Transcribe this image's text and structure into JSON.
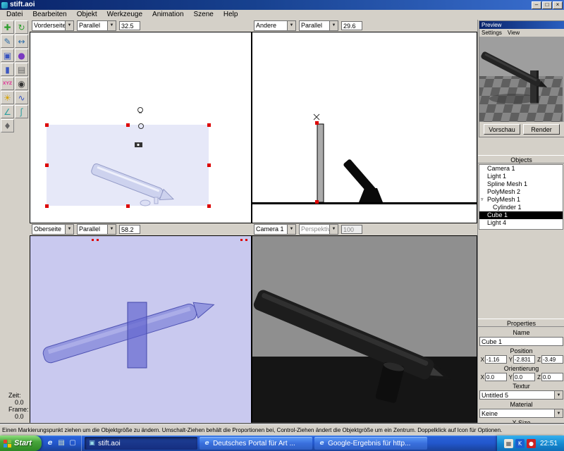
{
  "icons": {
    "chevron_down": "▼",
    "minimize": "–",
    "maximize": "□",
    "close": "×"
  },
  "window": {
    "title": "stift.aoi"
  },
  "menubar": [
    "Datei",
    "Bearbeiten",
    "Objekt",
    "Werkzeuge",
    "Animation",
    "Szene",
    "Help"
  ],
  "toolbar": {
    "tools": [
      {
        "name": "move-tool",
        "glyph": "✚",
        "style": "color:#2e9e2e"
      },
      {
        "name": "rotate-tool",
        "glyph": "↻",
        "style": "color:#2e9e2e"
      },
      {
        "name": "edit-points-tool",
        "glyph": "✎",
        "style": "color:#2f6ea8"
      },
      {
        "name": "scale-tool",
        "glyph": "↔",
        "style": "color:#2f6ea8"
      },
      {
        "name": "create-cube-tool",
        "glyph": "▣",
        "style": "color:#3a55c0"
      },
      {
        "name": "create-sphere-tool",
        "glyph": "●",
        "style": "color:#7a3ac0"
      },
      {
        "name": "create-cylinder-tool",
        "glyph": "▮",
        "style": "color:#3a55c0"
      },
      {
        "name": "create-stack-tool",
        "glyph": "▤",
        "style": "color:#666666"
      },
      {
        "name": "coordinate-axes-tool",
        "glyph": "XYZ",
        "style": "color:#e0409a;font-size:6px;font-weight:bold"
      },
      {
        "name": "create-camera-tool",
        "glyph": "◉",
        "style": "color:#333333"
      },
      {
        "name": "create-light-tool",
        "glyph": "☀",
        "style": "color:#d8a400"
      },
      {
        "name": "create-curve-tool",
        "glyph": "∿",
        "style": "color:#3a55c0"
      },
      {
        "name": "angle-tool",
        "glyph": "∠",
        "style": "color:#2e9e9e"
      },
      {
        "name": "create-spline-tool",
        "glyph": "ʃ",
        "style": "color:#2e9e9e"
      },
      {
        "name": "pin-tool",
        "glyph": "♦",
        "style": "color:#666666"
      }
    ]
  },
  "viewports": {
    "top_left": {
      "view": "Vorderseite",
      "projection": "Parallel",
      "scale": "32.5"
    },
    "top_right": {
      "view": "Andere",
      "projection": "Parallel",
      "scale": "29.6"
    },
    "bottom_left": {
      "view": "Oberseite",
      "projection": "Parallel",
      "scale": "58.2"
    },
    "bottom_right": {
      "view": "Camera 1",
      "projection": "Perspektive",
      "scale": "100"
    }
  },
  "preview": {
    "title": "Preview",
    "menus": [
      "Settings",
      "View"
    ],
    "buttons": [
      "Vorschau",
      "Render"
    ]
  },
  "objects": {
    "title": "Objects",
    "items": [
      {
        "label": "Camera 1",
        "marker": ""
      },
      {
        "label": "Light 1",
        "marker": ""
      },
      {
        "label": "Spline Mesh 1",
        "marker": ""
      },
      {
        "label": "PolyMesh 2",
        "marker": ""
      },
      {
        "label": "PolyMesh 1",
        "marker": "▿"
      },
      {
        "label": "Cylinder 1",
        "marker": ""
      },
      {
        "label": "Cube 1",
        "marker": ""
      },
      {
        "label": "Light 4",
        "marker": ""
      }
    ]
  },
  "properties": {
    "title": "Properties",
    "name_label": "Name",
    "name_value": "Cube 1",
    "position_label": "Position",
    "axis_labels": [
      "X",
      "Y",
      "Z"
    ],
    "position": {
      "x": "-1.16",
      "y": "-2.831",
      "z": "-3.49"
    },
    "orientation_label": "Orientierung",
    "orientation": {
      "x": "0.0",
      "y": "0.0",
      "z": "0.0"
    },
    "texture_label": "Textur",
    "texture_value": "Untitled 5",
    "material_label": "Material",
    "material_value": "Keine",
    "xsize_label": "X Size"
  },
  "time_panel": {
    "zeit_label": "Zeit:",
    "zeit_value": "0.0",
    "frame_label": "Frame:",
    "frame_value": "0.0"
  },
  "status_text": "Einen Markierungspunkt ziehen um die Objektgröße zu ändern. Umschalt-Ziehen behält die Proportionen bei, Control-Ziehen ändert die Objektgröße um ein Zentrum. Doppelklick auf Icon für Optionen.",
  "taskbar": {
    "start_label": "Start",
    "quick_launch": [
      {
        "glyph": "e",
        "style": "color:#cfe6ff;font-style:italic;font-weight:bold"
      },
      {
        "glyph": "▤",
        "style": "color:#d8e8c8"
      },
      {
        "glyph": "▢",
        "style": "color:#cfe0f8"
      }
    ],
    "tasks": [
      {
        "label": "stift.aoi",
        "icon": "▣",
        "icon_style": "color:#9adbe8",
        "active": true
      },
      {
        "label": "Deutsches Portal für Art ...",
        "icon": "e",
        "icon_style": "color:#cfe6ff;font-style:italic;font-weight:bold",
        "active": false
      },
      {
        "label": "Google-Ergebnis für http...",
        "icon": "e",
        "icon_style": "color:#cfe6ff;font-style:italic;font-weight:bold",
        "active": false
      }
    ],
    "tray_icons": [
      {
        "glyph": "▦",
        "style": "background:#e8e4da;color:#555"
      },
      {
        "glyph": "K",
        "style": "background:#1a5fd0;color:#fff"
      },
      {
        "glyph": "●",
        "style": "background:#cc2222;color:#fff"
      }
    ],
    "time": "22:51"
  },
  "appearance": {
    "chrome": "#d4d0c8",
    "titlebar_left": "#0a246a",
    "titlebar_right": "#3a6fd0",
    "selection_handle_red": "#dd0000",
    "viewport_top_bg": "#ffffff",
    "viewport_bottom_left_bg": "#c9c9ef",
    "viewport_bottom_right_bg": "#8f8f8f",
    "taskbar_blue": "#2257cc",
    "start_green": "#2f8a26",
    "selected_row_bg": "#000000"
  }
}
